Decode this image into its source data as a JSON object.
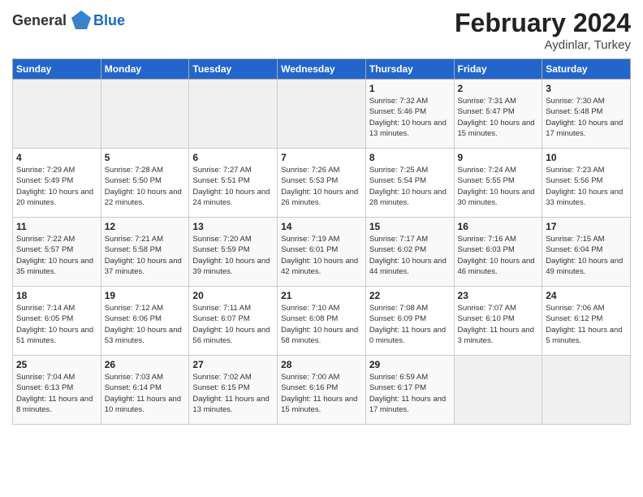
{
  "header": {
    "logo_general": "General",
    "logo_blue": "Blue",
    "month_title": "February 2024",
    "location": "Aydinlar, Turkey"
  },
  "weekdays": [
    "Sunday",
    "Monday",
    "Tuesday",
    "Wednesday",
    "Thursday",
    "Friday",
    "Saturday"
  ],
  "weeks": [
    [
      {
        "day": "",
        "empty": true
      },
      {
        "day": "",
        "empty": true
      },
      {
        "day": "",
        "empty": true
      },
      {
        "day": "",
        "empty": true
      },
      {
        "day": "1",
        "sunrise": "Sunrise: 7:32 AM",
        "sunset": "Sunset: 5:46 PM",
        "daylight": "Daylight: 10 hours and 13 minutes."
      },
      {
        "day": "2",
        "sunrise": "Sunrise: 7:31 AM",
        "sunset": "Sunset: 5:47 PM",
        "daylight": "Daylight: 10 hours and 15 minutes."
      },
      {
        "day": "3",
        "sunrise": "Sunrise: 7:30 AM",
        "sunset": "Sunset: 5:48 PM",
        "daylight": "Daylight: 10 hours and 17 minutes."
      }
    ],
    [
      {
        "day": "4",
        "sunrise": "Sunrise: 7:29 AM",
        "sunset": "Sunset: 5:49 PM",
        "daylight": "Daylight: 10 hours and 20 minutes."
      },
      {
        "day": "5",
        "sunrise": "Sunrise: 7:28 AM",
        "sunset": "Sunset: 5:50 PM",
        "daylight": "Daylight: 10 hours and 22 minutes."
      },
      {
        "day": "6",
        "sunrise": "Sunrise: 7:27 AM",
        "sunset": "Sunset: 5:51 PM",
        "daylight": "Daylight: 10 hours and 24 minutes."
      },
      {
        "day": "7",
        "sunrise": "Sunrise: 7:26 AM",
        "sunset": "Sunset: 5:53 PM",
        "daylight": "Daylight: 10 hours and 26 minutes."
      },
      {
        "day": "8",
        "sunrise": "Sunrise: 7:25 AM",
        "sunset": "Sunset: 5:54 PM",
        "daylight": "Daylight: 10 hours and 28 minutes."
      },
      {
        "day": "9",
        "sunrise": "Sunrise: 7:24 AM",
        "sunset": "Sunset: 5:55 PM",
        "daylight": "Daylight: 10 hours and 30 minutes."
      },
      {
        "day": "10",
        "sunrise": "Sunrise: 7:23 AM",
        "sunset": "Sunset: 5:56 PM",
        "daylight": "Daylight: 10 hours and 33 minutes."
      }
    ],
    [
      {
        "day": "11",
        "sunrise": "Sunrise: 7:22 AM",
        "sunset": "Sunset: 5:57 PM",
        "daylight": "Daylight: 10 hours and 35 minutes."
      },
      {
        "day": "12",
        "sunrise": "Sunrise: 7:21 AM",
        "sunset": "Sunset: 5:58 PM",
        "daylight": "Daylight: 10 hours and 37 minutes."
      },
      {
        "day": "13",
        "sunrise": "Sunrise: 7:20 AM",
        "sunset": "Sunset: 5:59 PM",
        "daylight": "Daylight: 10 hours and 39 minutes."
      },
      {
        "day": "14",
        "sunrise": "Sunrise: 7:19 AM",
        "sunset": "Sunset: 6:01 PM",
        "daylight": "Daylight: 10 hours and 42 minutes."
      },
      {
        "day": "15",
        "sunrise": "Sunrise: 7:17 AM",
        "sunset": "Sunset: 6:02 PM",
        "daylight": "Daylight: 10 hours and 44 minutes."
      },
      {
        "day": "16",
        "sunrise": "Sunrise: 7:16 AM",
        "sunset": "Sunset: 6:03 PM",
        "daylight": "Daylight: 10 hours and 46 minutes."
      },
      {
        "day": "17",
        "sunrise": "Sunrise: 7:15 AM",
        "sunset": "Sunset: 6:04 PM",
        "daylight": "Daylight: 10 hours and 49 minutes."
      }
    ],
    [
      {
        "day": "18",
        "sunrise": "Sunrise: 7:14 AM",
        "sunset": "Sunset: 6:05 PM",
        "daylight": "Daylight: 10 hours and 51 minutes."
      },
      {
        "day": "19",
        "sunrise": "Sunrise: 7:12 AM",
        "sunset": "Sunset: 6:06 PM",
        "daylight": "Daylight: 10 hours and 53 minutes."
      },
      {
        "day": "20",
        "sunrise": "Sunrise: 7:11 AM",
        "sunset": "Sunset: 6:07 PM",
        "daylight": "Daylight: 10 hours and 56 minutes."
      },
      {
        "day": "21",
        "sunrise": "Sunrise: 7:10 AM",
        "sunset": "Sunset: 6:08 PM",
        "daylight": "Daylight: 10 hours and 58 minutes."
      },
      {
        "day": "22",
        "sunrise": "Sunrise: 7:08 AM",
        "sunset": "Sunset: 6:09 PM",
        "daylight": "Daylight: 11 hours and 0 minutes."
      },
      {
        "day": "23",
        "sunrise": "Sunrise: 7:07 AM",
        "sunset": "Sunset: 6:10 PM",
        "daylight": "Daylight: 11 hours and 3 minutes."
      },
      {
        "day": "24",
        "sunrise": "Sunrise: 7:06 AM",
        "sunset": "Sunset: 6:12 PM",
        "daylight": "Daylight: 11 hours and 5 minutes."
      }
    ],
    [
      {
        "day": "25",
        "sunrise": "Sunrise: 7:04 AM",
        "sunset": "Sunset: 6:13 PM",
        "daylight": "Daylight: 11 hours and 8 minutes."
      },
      {
        "day": "26",
        "sunrise": "Sunrise: 7:03 AM",
        "sunset": "Sunset: 6:14 PM",
        "daylight": "Daylight: 11 hours and 10 minutes."
      },
      {
        "day": "27",
        "sunrise": "Sunrise: 7:02 AM",
        "sunset": "Sunset: 6:15 PM",
        "daylight": "Daylight: 11 hours and 13 minutes."
      },
      {
        "day": "28",
        "sunrise": "Sunrise: 7:00 AM",
        "sunset": "Sunset: 6:16 PM",
        "daylight": "Daylight: 11 hours and 15 minutes."
      },
      {
        "day": "29",
        "sunrise": "Sunrise: 6:59 AM",
        "sunset": "Sunset: 6:17 PM",
        "daylight": "Daylight: 11 hours and 17 minutes."
      },
      {
        "day": "",
        "empty": true
      },
      {
        "day": "",
        "empty": true
      }
    ]
  ]
}
